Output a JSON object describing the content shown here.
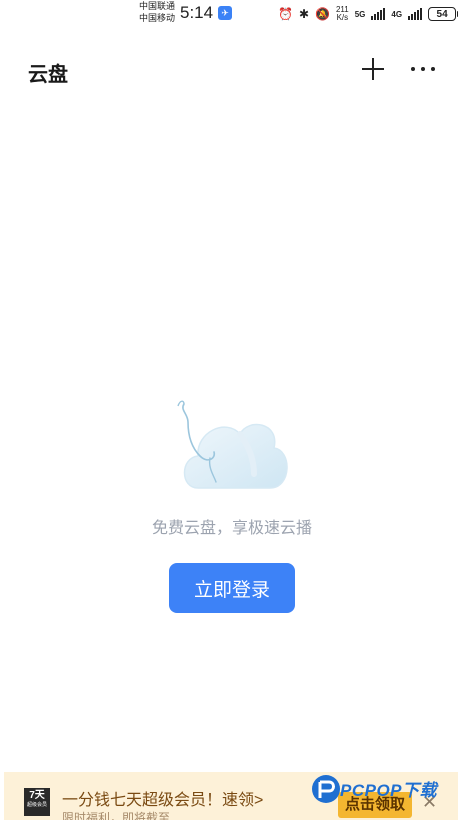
{
  "status_bar": {
    "carrier_1": "中国联通",
    "carrier_2": "中国移动",
    "time": "5:14",
    "net_rate_value": "211",
    "net_rate_unit": "K/s",
    "net_type_1": "5G",
    "net_type_2": "4G",
    "battery": "54"
  },
  "header": {
    "title": "云盘"
  },
  "empty_state": {
    "message": "免费云盘，享极速云播",
    "login_button": "立即登录"
  },
  "ad": {
    "logo_text": "7天",
    "logo_sub": "超级会员",
    "title": "一分钱七天超级会员！速领>",
    "subtitle": "限时福利，即将截至",
    "cta": "点击领取",
    "close": "✕"
  },
  "watermark": {
    "text": "PCPOP下载"
  },
  "colors": {
    "primary": "#3d82f7",
    "ad_background": "#fdf1d8",
    "ad_cta": "#f4b630",
    "muted_text": "#9ca3af"
  }
}
